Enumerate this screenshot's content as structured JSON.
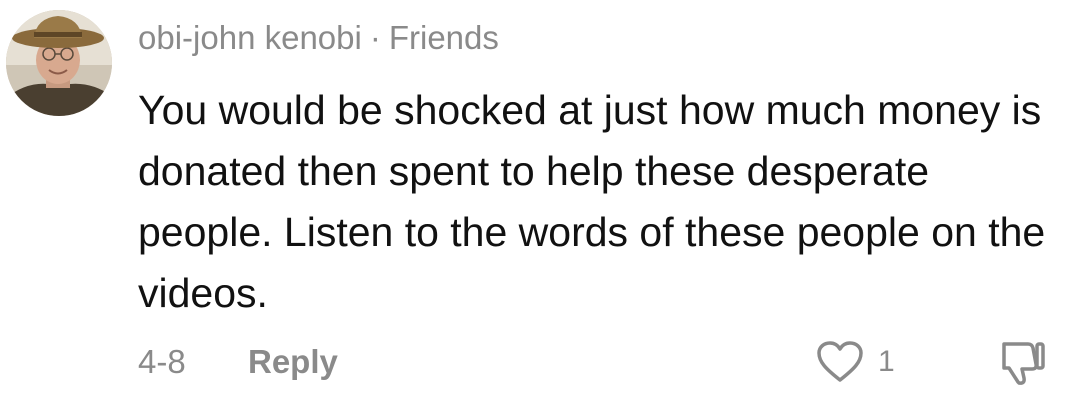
{
  "comment": {
    "username": "obi-john kenobi",
    "separator": "·",
    "relationship": "Friends",
    "text": "You would be shocked at just how much money is donated then spent to help these desperate people. Listen to the words of these people on the videos.",
    "date": "4-8",
    "reply_label": "Reply",
    "like_count": "1",
    "icons": {
      "avatar": "avatar-photo",
      "like": "heart-outline-icon",
      "dislike": "thumbs-down-outline-icon"
    },
    "colors": {
      "meta_text": "#8a8a8a",
      "body_text": "#111111",
      "background": "#ffffff"
    }
  }
}
